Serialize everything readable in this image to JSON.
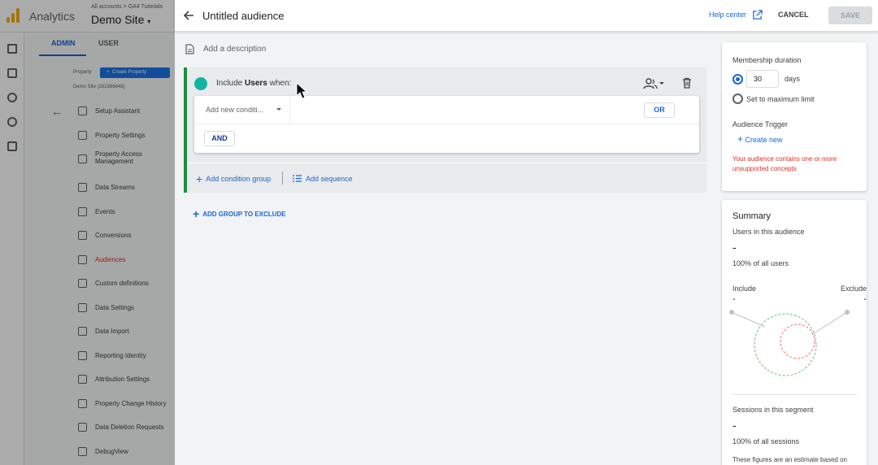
{
  "ga": {
    "app_name": "Analytics",
    "breadcrumb": "All accounts > GA4 Tutorials",
    "site_name": "Demo Site",
    "tabs": [
      "ADMIN",
      "USER"
    ],
    "property_label": "Property",
    "create_property": "Create Property",
    "property_id": "Demo Site (332266648)",
    "menu": [
      {
        "label": "Setup Assistant",
        "icon": "checklist-icon"
      },
      {
        "label": "Property Settings",
        "icon": "settings-icon"
      },
      {
        "label": "Property Access Management",
        "icon": "people-icon"
      },
      {
        "label": "Data Streams",
        "icon": "streams-icon"
      },
      {
        "label": "Events",
        "icon": "touch-icon"
      },
      {
        "label": "Conversions",
        "icon": "flag-icon"
      },
      {
        "label": "Audiences",
        "icon": "audience-icon",
        "active": true
      },
      {
        "label": "Custom definitions",
        "icon": "shapes-icon"
      },
      {
        "label": "Data Settings",
        "icon": "database-icon"
      },
      {
        "label": "Data Import",
        "icon": "upload-icon"
      },
      {
        "label": "Reporting Identity",
        "icon": "identity-icon"
      },
      {
        "label": "Attribution Settings",
        "icon": "attribution-icon"
      },
      {
        "label": "Property Change History",
        "icon": "history-icon"
      },
      {
        "label": "Data Deletion Requests",
        "icon": "deletion-icon"
      },
      {
        "label": "DebugView",
        "icon": "debug-icon"
      }
    ]
  },
  "header": {
    "title": "Untitled audience",
    "help_center": "Help center",
    "cancel": "CANCEL",
    "save": "SAVE"
  },
  "description_placeholder": "Add a description",
  "include_group": {
    "prefix": "Include",
    "scope": "Users",
    "suffix": "when:",
    "condition_placeholder": "Add new conditi...",
    "or_label": "OR",
    "and_label": "AND",
    "add_condition_group": "Add condition group",
    "add_sequence": "Add sequence",
    "accent_color": "#12b5a0"
  },
  "add_group_to_exclude": "ADD GROUP TO EXCLUDE",
  "membership": {
    "title": "Membership duration",
    "days_value": "30",
    "days_label": "days",
    "max_limit_label": "Set to maximum limit",
    "trigger_title": "Audience Trigger",
    "create_new": "Create new",
    "warning": "Your audience contains one or more unsupported concepts",
    "warning_color": "#d93025"
  },
  "summary": {
    "title": "Summary",
    "users_label": "Users in this audience",
    "users_value": "-",
    "users_pct": "100% of all users",
    "include_label": "Include",
    "exclude_label": "Exclude",
    "include_value": "-",
    "exclude_value": "-",
    "sessions_label": "Sessions in this segment",
    "sessions_value": "-",
    "sessions_pct": "100% of all sessions",
    "note": "These figures are an estimate based on"
  }
}
